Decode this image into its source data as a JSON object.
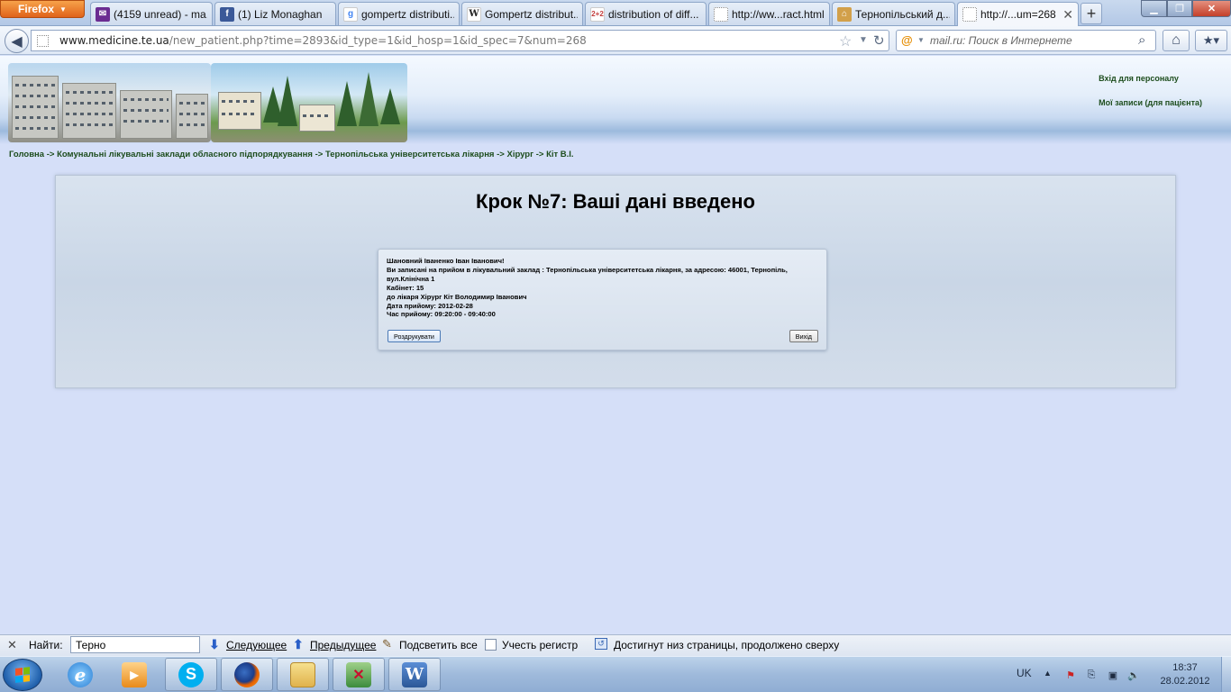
{
  "browser": {
    "menu_button": "Firefox",
    "tabs": [
      {
        "title": "(4159 unread) - ma...",
        "icon": "yahoo-mail-icon",
        "color": "#6b2c91"
      },
      {
        "title": "(1) Liz Monaghan",
        "icon": "facebook-icon",
        "color": "#3b5998"
      },
      {
        "title": "gompertz distributi...",
        "icon": "google-icon",
        "color": "#4285f4"
      },
      {
        "title": "Gompertz distribut...",
        "icon": "wikipedia-icon",
        "color": "#222222"
      },
      {
        "title": "distribution of diff...",
        "icon": "math-site-icon",
        "color": "#c33c3c"
      },
      {
        "title": "http://ww...ract.html",
        "icon": "blank-page-icon",
        "color": "#999999"
      },
      {
        "title": "Тернопільський д...",
        "icon": "hospital-site-icon",
        "color": "#d2a04a"
      },
      {
        "title": "http://...um=268",
        "icon": "blank-page-icon",
        "color": "#999999"
      }
    ],
    "url_domain": "www.medicine.te.ua",
    "url_path": "/new_patient.php?time=2893&id_type=1&id_hosp=1&id_spec=7&num=268",
    "search_placeholder": "mail.ru: Поиск в Интернете"
  },
  "page": {
    "staff_login": "Вхід для персоналу",
    "my_records": "Мої записи (для пацієнта)",
    "breadcrumb": [
      "Головна",
      "Комунальні лікувальні заклади обласного підпорядкування",
      "Тернопільська університетська лікарня",
      "Хірург",
      "Кіт В.І."
    ],
    "breadcrumb_sep": " -> ",
    "title": "Крок №7: Ваші дані введено",
    "info_lines": [
      "Шановний Іваненко Іван Іванович!",
      "Ви записані на прийом в лікувальний заклад : Тернопільська університетська лікарня, за адресою: 46001, Тернопіль, вул.Клінічна 1",
      "Кабінет: 15",
      "до лікаря Хірург Кіт Володимир Іванович",
      "Дата прийому: 2012-02-28",
      "Час прийому: 09:20:00 - 09:40:00"
    ],
    "print_button": "Роздрукувати",
    "exit_button": "Вихід"
  },
  "findbar": {
    "label": "Найти:",
    "query": "Терно",
    "next": "Следующее",
    "prev": "Предыдущее",
    "highlight": "Подсветить все",
    "match_case": "Учесть регистр",
    "status": "Достигнут низ страницы, продолжено сверху"
  },
  "taskbar": {
    "apps": [
      {
        "name": "internet-explorer-icon",
        "color": "#2a7fd4",
        "open": false
      },
      {
        "name": "media-player-icon",
        "color": "#e88a1a",
        "open": false
      },
      {
        "name": "skype-icon",
        "color": "#00aff0",
        "open": true
      },
      {
        "name": "firefox-icon",
        "color": "#e66000",
        "open": true
      },
      {
        "name": "file-explorer-icon",
        "color": "#e8c560",
        "open": true
      },
      {
        "name": "spreadsheet-app-icon",
        "color": "#3c8c3c",
        "open": true
      },
      {
        "name": "word-icon",
        "color": "#2b5797",
        "open": true
      }
    ],
    "language": "UK",
    "time": "18:37",
    "date": "28.02.2012"
  }
}
